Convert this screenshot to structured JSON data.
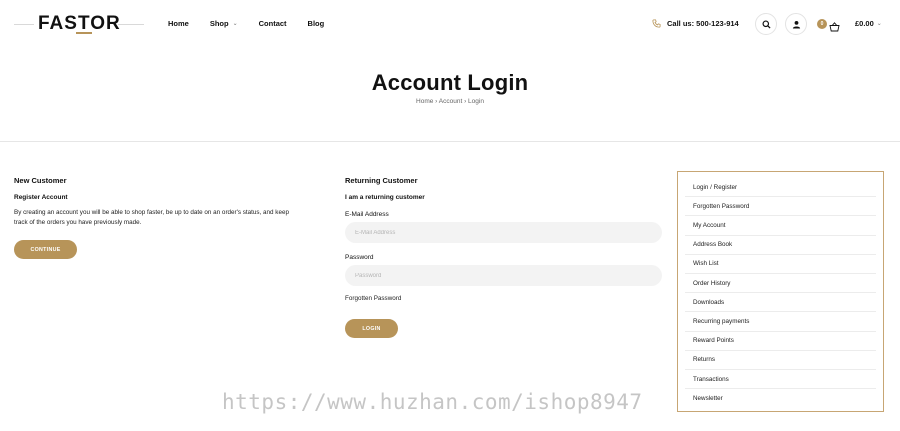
{
  "brand": {
    "logo": "FASTOR",
    "accent_color": "#b79459"
  },
  "nav": [
    {
      "label": "Home"
    },
    {
      "label": "Shop",
      "has_dropdown": true
    },
    {
      "label": "Contact"
    },
    {
      "label": "Blog"
    }
  ],
  "header": {
    "call_text": "Call us: 500-123-914",
    "cart_count": "0",
    "cart_total": "£0.00",
    "icons": [
      "phone-icon",
      "search-icon",
      "user-icon",
      "basket-icon",
      "chevron-down-icon"
    ]
  },
  "page": {
    "title": "Account Login",
    "breadcrumb": "Home › Account › Login"
  },
  "new_customer": {
    "heading": "New Customer",
    "subheading": "Register Account",
    "text_line1": "By creating an account you will be able to shop faster, be up to date on an order's status, and keep",
    "text_line2": "track of the orders you have previously made.",
    "button": "CONTINUE"
  },
  "returning_customer": {
    "heading": "Returning Customer",
    "subheading": "I am a returning customer",
    "email_label": "E-Mail Address",
    "email_placeholder": "E-Mail Address",
    "email_value": "",
    "password_label": "Password",
    "password_placeholder": "Password",
    "password_value": "",
    "forgot_link": "Forgotten Password",
    "button": "LOGIN"
  },
  "sidebar": {
    "items": [
      {
        "label": "Login / Register"
      },
      {
        "label": "Forgotten Password"
      },
      {
        "label": "My Account"
      },
      {
        "label": "Address Book"
      },
      {
        "label": "Wish List"
      },
      {
        "label": "Order History"
      },
      {
        "label": "Downloads"
      },
      {
        "label": "Recurring payments"
      },
      {
        "label": "Reward Points"
      },
      {
        "label": "Returns"
      },
      {
        "label": "Transactions"
      },
      {
        "label": "Newsletter"
      }
    ]
  },
  "watermark": "https://www.huzhan.com/ishop8947"
}
